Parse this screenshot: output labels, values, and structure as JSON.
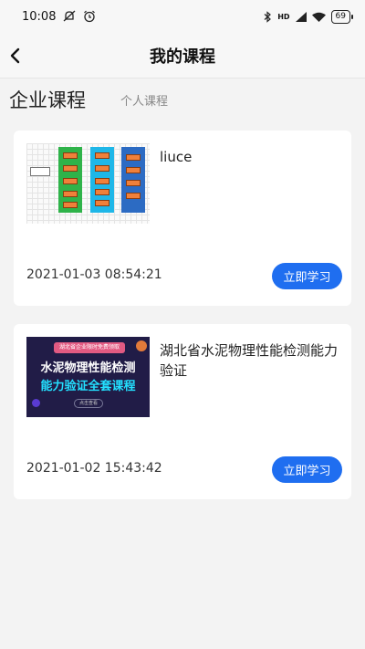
{
  "status_bar": {
    "time": "10:08",
    "network": "HD",
    "battery": "69",
    "icons": [
      "notification-off-icon",
      "alarm-icon",
      "bluetooth-icon",
      "signal-icon",
      "wifi-icon",
      "battery-icon"
    ]
  },
  "navbar": {
    "title": "我的课程",
    "back_icon": "chevron-left-icon"
  },
  "tabs": {
    "active": "企业课程",
    "inactive": "个人课程"
  },
  "courses": [
    {
      "title": "liuce",
      "date": "2021-01-03 08:54:21",
      "button": "立即学习"
    },
    {
      "title": "湖北省水泥物理性能检测能力验证",
      "date": "2021-01-02 15:43:42",
      "button": "立即学习",
      "thumbnail": {
        "banner": "湖北省企业限时免费领取",
        "line1": "水泥物理性能检测",
        "line2": "能力验证全套课程",
        "chip": "点击查看"
      }
    }
  ],
  "colors": {
    "accent": "#1f6ef0",
    "background": "#f3f3f3"
  }
}
